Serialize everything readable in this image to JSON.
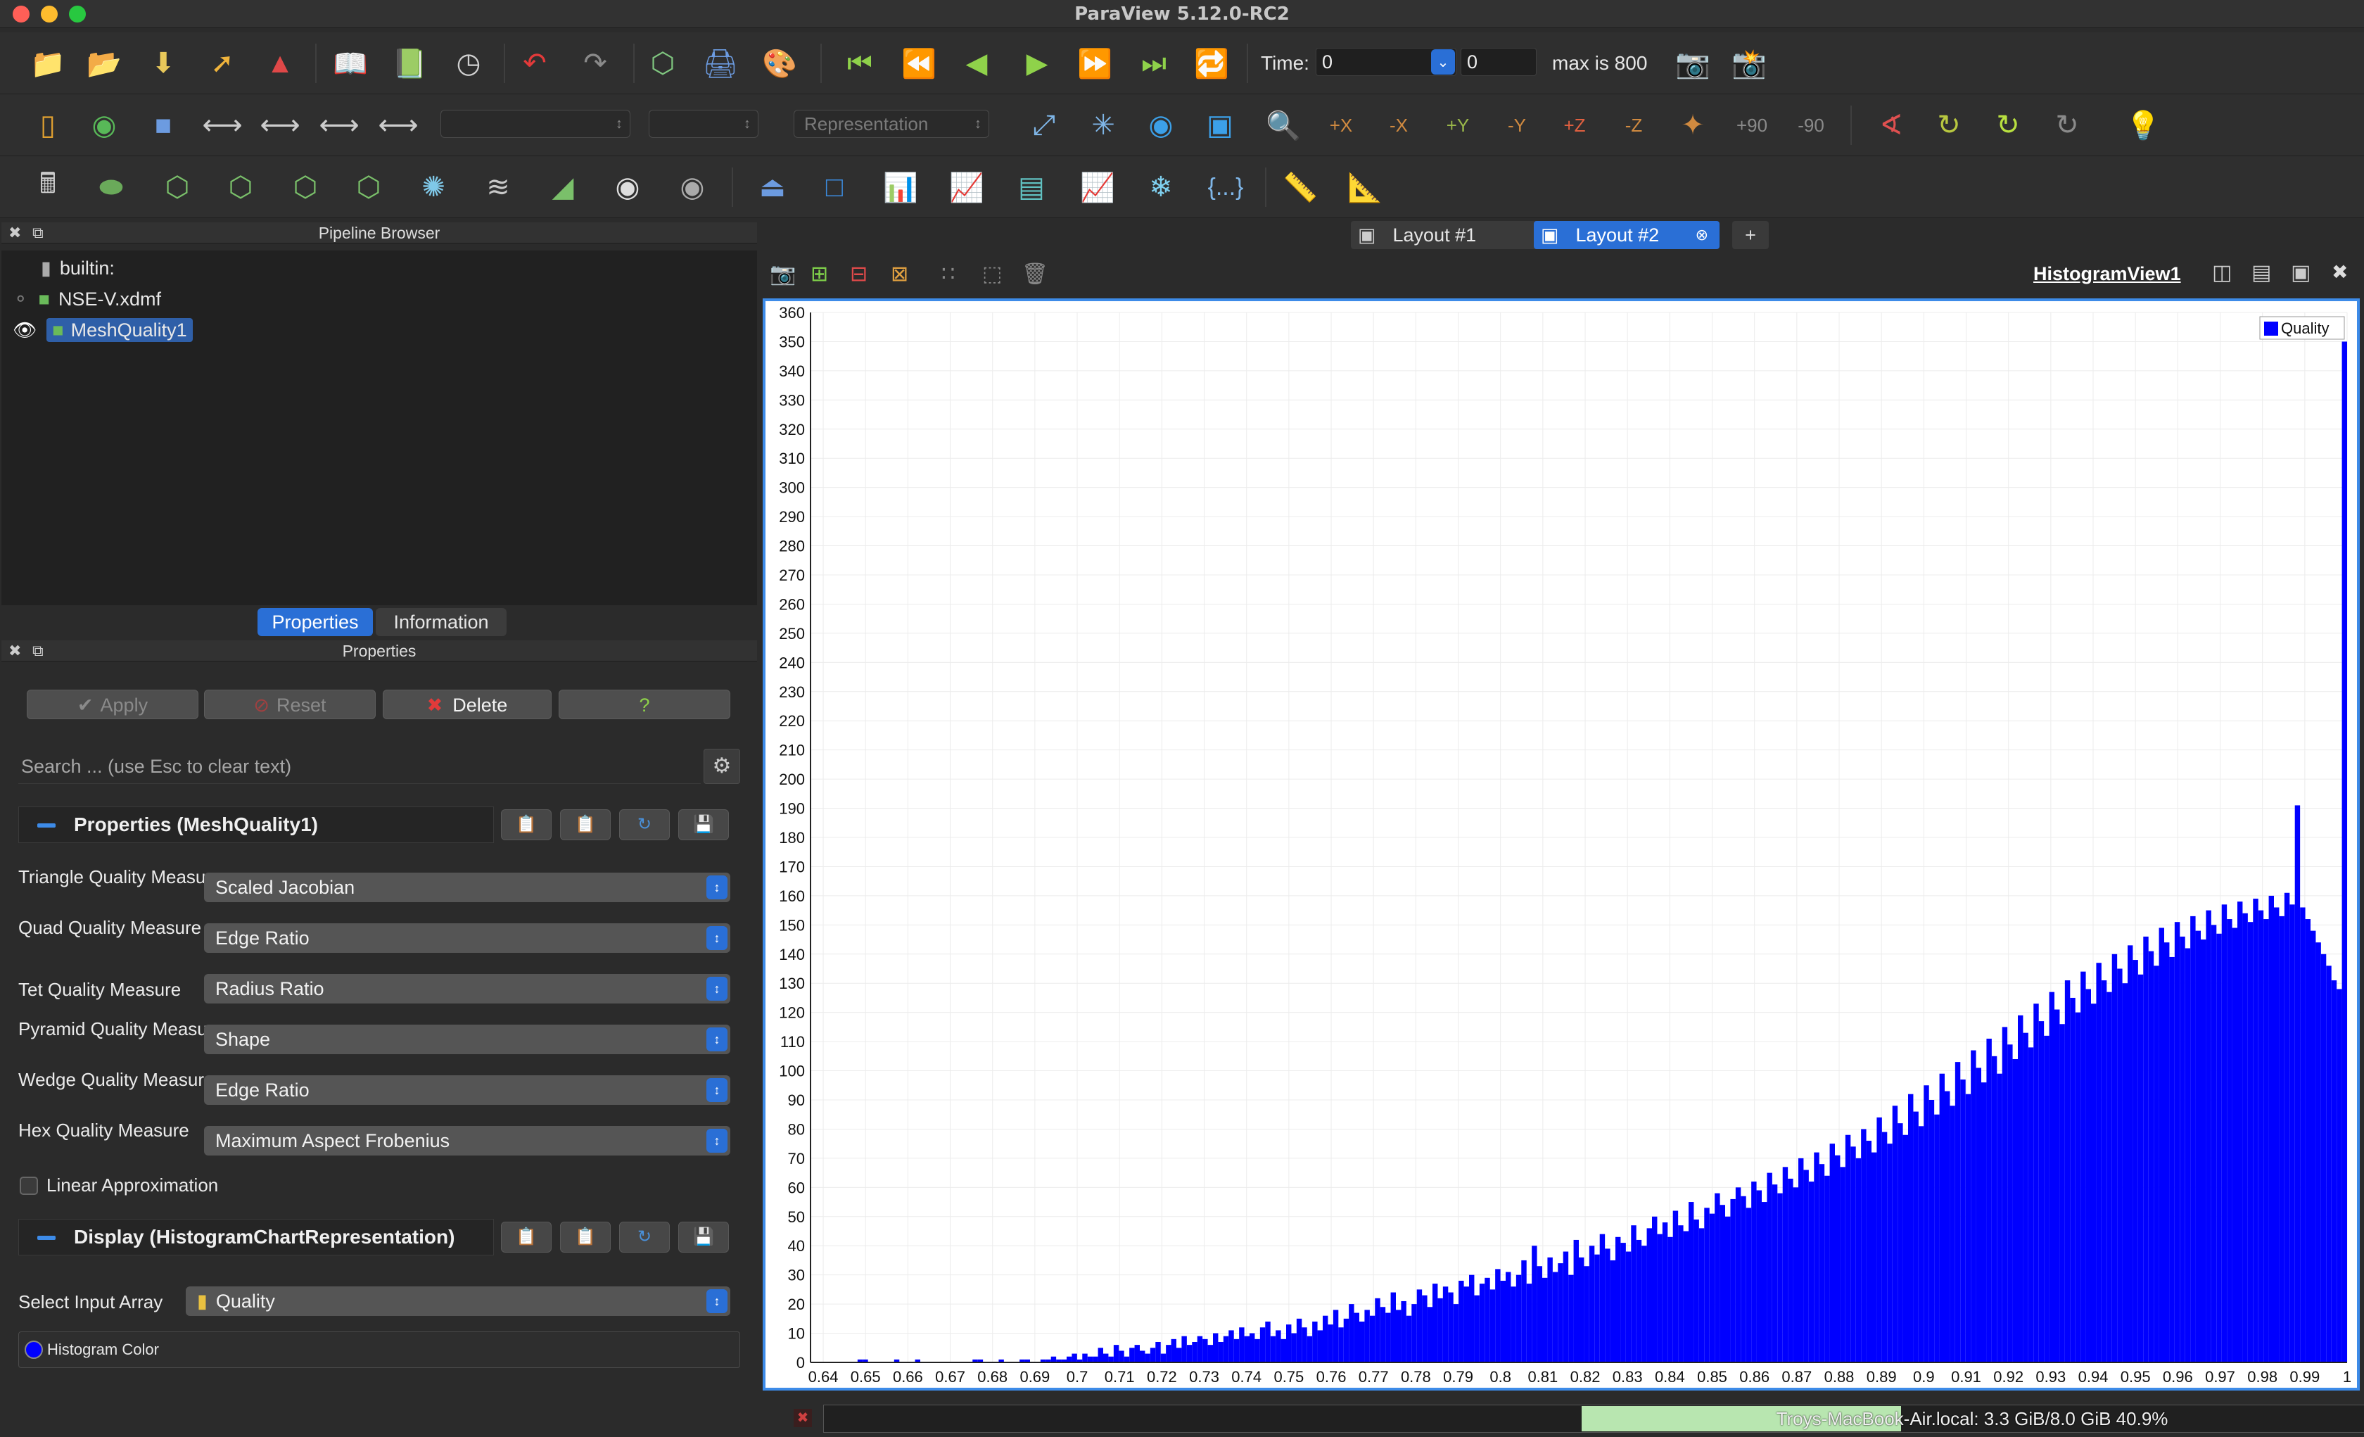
{
  "window": {
    "title": "ParaView 5.12.0-RC2"
  },
  "colors": {
    "accent": "#2a6fd6",
    "histogram": "#0000ff",
    "selection": "#2f5fa8",
    "close_red": "#e23a3a"
  },
  "toolbar": {
    "time_label": "Time:",
    "time_value": "0",
    "time_index": "0",
    "max_text": "max is 800",
    "representation_placeholder": "Representation",
    "icons": [
      "open-folder-icon",
      "recent-folder-icon",
      "save-data-icon",
      "connect-icon",
      "paraview-logo-icon",
      "load-state-icon",
      "save-state-icon",
      "reset-session-icon",
      "undo-icon",
      "redo-icon",
      "camera-link-icon",
      "screenshot-icon",
      "palette-icon",
      "first-frame-icon",
      "previous-frame-icon",
      "play-backward-icon",
      "play-icon",
      "next-frame-icon",
      "last-frame-icon",
      "loop-icon"
    ],
    "camera_labels": [
      "+X",
      "-X",
      "+Y",
      "-Y",
      "+Z",
      "-Z",
      "+90",
      "-90"
    ]
  },
  "pipeline_browser": {
    "title": "Pipeline Browser",
    "items": [
      {
        "label": "builtin:"
      },
      {
        "label": "NSE-V.xdmf"
      },
      {
        "label": "MeshQuality1"
      }
    ]
  },
  "tabs": {
    "properties": "Properties",
    "information": "Information"
  },
  "properties_panel": {
    "title": "Properties",
    "apply": "Apply",
    "reset": "Reset",
    "delete": "Delete",
    "help": "?",
    "search_placeholder": "Search ... (use Esc to clear text)",
    "section_properties": "Properties (MeshQuality1)",
    "section_display": "Display (HistogramChartRepresentation)",
    "rows": [
      {
        "label": "Triangle Quality Measure",
        "value": "Scaled Jacobian"
      },
      {
        "label": "Quad Quality Measure",
        "value": "Edge Ratio"
      },
      {
        "label": "Tet Quality Measure",
        "value": "Radius Ratio"
      },
      {
        "label": "Pyramid Quality Measure",
        "value": "Shape"
      },
      {
        "label": "Wedge Quality Measure",
        "value": "Edge Ratio"
      },
      {
        "label": "Hex Quality Measure",
        "value": "Maximum Aspect Frobenius"
      }
    ],
    "linear_approx": "Linear Approximation",
    "select_input_array_label": "Select Input Array",
    "select_input_array_value": "Quality",
    "histogram_color": "Histogram Color"
  },
  "layout_tabs": {
    "layout1": "Layout #1",
    "layout2": "Layout #2",
    "add": "+"
  },
  "view": {
    "name": "HistogramView1"
  },
  "status": {
    "memory": "Troys-MacBook-Air.local: 3.3 GiB/8.0 GiB 40.9%",
    "memory_fraction": 0.409
  },
  "chart_data": {
    "type": "bar",
    "legend": [
      "Quality"
    ],
    "legend_position": "top-right",
    "grid": true,
    "xlim": [
      0.637,
      1.0
    ],
    "ylim": [
      0,
      360
    ],
    "x_ticks": [
      "0.64",
      "0.65",
      "0.66",
      "0.67",
      "0.68",
      "0.69",
      "0.7",
      "0.71",
      "0.72",
      "0.73",
      "0.74",
      "0.75",
      "0.76",
      "0.77",
      "0.78",
      "0.79",
      "0.8",
      "0.81",
      "0.82",
      "0.83",
      "0.84",
      "0.85",
      "0.86",
      "0.87",
      "0.88",
      "0.89",
      "0.9",
      "0.91",
      "0.92",
      "0.93",
      "0.94",
      "0.95",
      "0.96",
      "0.97",
      "0.98",
      "0.99",
      "1"
    ],
    "y_ticks": [
      0,
      10,
      20,
      30,
      40,
      50,
      60,
      70,
      80,
      90,
      100,
      110,
      120,
      130,
      140,
      150,
      160,
      170,
      180,
      190,
      200,
      210,
      220,
      230,
      240,
      250,
      260,
      270,
      280,
      290,
      300,
      310,
      320,
      330,
      340,
      350,
      360
    ],
    "series": [
      {
        "name": "Quality",
        "values": [
          0,
          0,
          0,
          0,
          0,
          0,
          0,
          0,
          0,
          1,
          1,
          0,
          0,
          0,
          0,
          0,
          1,
          0,
          0,
          0,
          1,
          0,
          0,
          0,
          0,
          0,
          0,
          0,
          0,
          0,
          0,
          1,
          1,
          0,
          0,
          0,
          1,
          0,
          0,
          0,
          1,
          1,
          0,
          0,
          1,
          1,
          2,
          1,
          1,
          2,
          3,
          1,
          3,
          2,
          2,
          5,
          3,
          2,
          6,
          4,
          2,
          5,
          6,
          4,
          3,
          5,
          7,
          3,
          6,
          8,
          5,
          9,
          6,
          7,
          9,
          8,
          6,
          10,
          7,
          9,
          11,
          8,
          12,
          9,
          10,
          8,
          12,
          14,
          9,
          11,
          8,
          13,
          10,
          15,
          12,
          9,
          14,
          11,
          16,
          13,
          18,
          12,
          15,
          20,
          17,
          14,
          18,
          16,
          22,
          19,
          17,
          24,
          18,
          21,
          16,
          20,
          25,
          23,
          19,
          27,
          22,
          26,
          24,
          20,
          28,
          26,
          30,
          23,
          27,
          29,
          25,
          32,
          28,
          31,
          26,
          30,
          35,
          27,
          40,
          33,
          29,
          36,
          31,
          34,
          38,
          30,
          42,
          36,
          33,
          40,
          37,
          44,
          39,
          35,
          43,
          41,
          38,
          47,
          42,
          40,
          46,
          50,
          44,
          48,
          43,
          52,
          47,
          45,
          55,
          49,
          46,
          53,
          51,
          58,
          54,
          50,
          56,
          60,
          57,
          53,
          62,
          59,
          55,
          65,
          61,
          58,
          67,
          63,
          60,
          70,
          66,
          62,
          72,
          68,
          64,
          75,
          71,
          67,
          78,
          74,
          70,
          80,
          76,
          72,
          84,
          79,
          75,
          88,
          82,
          78,
          92,
          86,
          81,
          95,
          90,
          85,
          99,
          93,
          88,
          103,
          97,
          92,
          107,
          101,
          96,
          111,
          105,
          99,
          115,
          109,
          104,
          119,
          113,
          108,
          123,
          117,
          112,
          127,
          121,
          116,
          131,
          125,
          120,
          134,
          128,
          123,
          137,
          131,
          127,
          140,
          135,
          130,
          143,
          138,
          133,
          146,
          141,
          136,
          149,
          144,
          139,
          151,
          146,
          142,
          153,
          148,
          145,
          155,
          150,
          147,
          157,
          152,
          149,
          158,
          154,
          151,
          159,
          155,
          152,
          160,
          156,
          153,
          161,
          157,
          191,
          156,
          152,
          148,
          144,
          140,
          136,
          131,
          128,
          350
        ]
      }
    ]
  }
}
